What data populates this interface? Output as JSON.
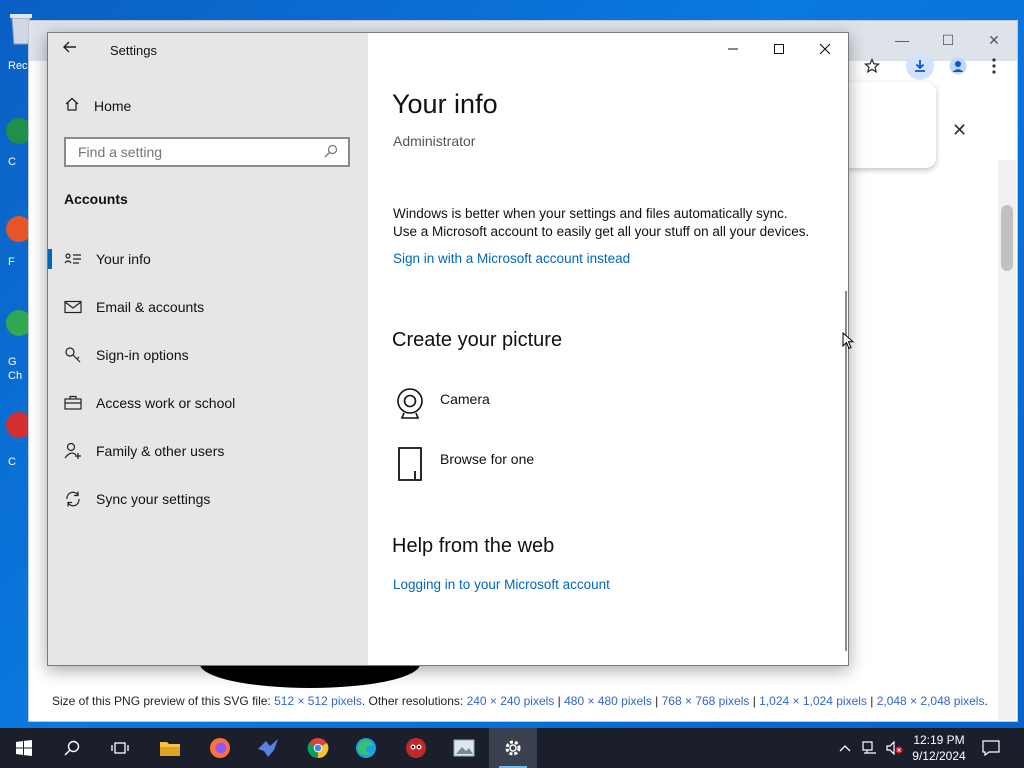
{
  "settings": {
    "window_title": "Settings",
    "sidebar": {
      "home_label": "Home",
      "search_placeholder": "Find a setting",
      "section_title": "Accounts",
      "items": [
        {
          "label": "Your info",
          "icon": "contact-card-icon"
        },
        {
          "label": "Email & accounts",
          "icon": "mail-icon"
        },
        {
          "label": "Sign-in options",
          "icon": "key-icon"
        },
        {
          "label": "Access work or school",
          "icon": "briefcase-icon"
        },
        {
          "label": "Family & other users",
          "icon": "add-person-icon"
        },
        {
          "label": "Sync your settings",
          "icon": "sync-icon"
        }
      ],
      "active_index": 0
    },
    "main": {
      "title": "Your info",
      "user_name": "Administrator",
      "sync_line1": "Windows is better when your settings and files automatically sync.",
      "sync_line2": "Use a Microsoft account to easily get all your stuff on all your devices.",
      "sign_in_link": "Sign in with a Microsoft account instead",
      "picture_heading": "Create your picture",
      "camera_label": "Camera",
      "browse_label": "Browse for one",
      "help_heading": "Help from the web",
      "help_link": "Logging in to your Microsoft account"
    }
  },
  "browser": {
    "footer_prefix": "Size of this PNG preview of this SVG file:",
    "footer_main_link": "512 × 512 pixels",
    "footer_mid": ". Other resolutions:",
    "footer_links": [
      "240 × 240 pixels",
      "480 × 480 pixels",
      "768 × 768 pixels",
      "1,024 × 1,024 pixels",
      "2,048 × 2,048 pixels"
    ],
    "footer_end": "."
  },
  "desktop": {
    "icon_labels": [
      "Rec",
      "C",
      "F",
      "G",
      "Ch",
      "C"
    ]
  },
  "taskbar": {
    "time": "12:19 PM",
    "date": "9/12/2024",
    "apps": [
      "start-icon",
      "search-icon",
      "task-view-icon",
      "file-explorer-icon",
      "firefox-icon",
      "bird-app-icon",
      "chrome-icon",
      "edge-icon",
      "app-icon",
      "image-viewer-icon",
      "settings-gear-icon"
    ]
  },
  "colors": {
    "accent": "#0067c0",
    "sidebar_bg": "#e6e6e6",
    "taskbar_bg": "#1a1f2b",
    "desktop_bg": "#0a63c9"
  }
}
